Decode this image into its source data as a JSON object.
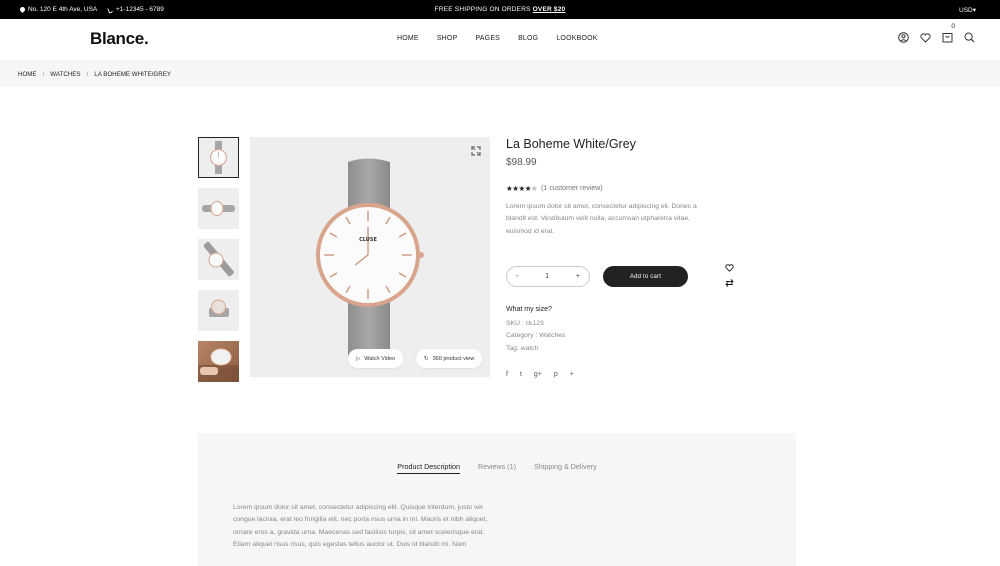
{
  "topbar": {
    "address": "No. 120 E 4th Ave, USA",
    "phone": "+1-12345 - 6789",
    "promo_text": "FREE SHIPPING ON ORDERS",
    "promo_amount": "OVER $20",
    "currency": "USD"
  },
  "header": {
    "logo": "Blance.",
    "nav": [
      "HOME",
      "SHOP",
      "PAGES",
      "BLOG",
      "LOOKBOOK"
    ],
    "cart_count": "0",
    "icons": [
      "user-icon",
      "heart-icon",
      "cart-icon",
      "search-icon"
    ]
  },
  "breadcrumb": [
    "HOME",
    "WATCHES",
    "LA BOHEME WHITE/GREY"
  ],
  "gallery": {
    "brand_on_dial": "CLUSE",
    "video_label": "Watch Video",
    "view360_label": "360 product view"
  },
  "product": {
    "title": "La Boheme White/Grey",
    "price": "$98.99",
    "rating_stars": 4,
    "rating_max": 5,
    "review_text": "(1 customer review)",
    "description": "Lorem ipsum dolor sit amet, consectetur adipiscing eli. Donec a blandit est. Vestibulum velit nulla, accumsan utpharetra vitae, euismod id erat.",
    "qty_minus": "-",
    "qty_value": "1",
    "qty_plus": "+",
    "add_to_cart": "Add to cart",
    "size_link": "What my size?",
    "sku": "SKU : ck123",
    "category": "Category : Watches",
    "tag": "Tag: watch",
    "social": [
      "f",
      "t",
      "g+",
      "p",
      "+"
    ]
  },
  "tabs": {
    "items": [
      "Product Description",
      "Reviews (1)",
      "Shipping & Delivery"
    ],
    "active": 0,
    "body": "Lorem ipsum dolor sit amet, consectetur adipiscing elit. Quisque interdum, justo vel congue lacinia, erat leo fringilla elit, nec porta risus urna in mi. Mauris et nibh aliquet, ornare eros a, gravida urna. Maecenas sed facilisis turpis, sit amet scelerisque erat. Etiam aliquet risus risus, quis egestas tellus auctor ut. Duis id blandit mi. Nam"
  },
  "colors": {
    "topbar_bg": "#000000",
    "accent_dark": "#222222",
    "muted_text": "#888888",
    "panel_bg": "#f6f6f6",
    "strap_grey": "#9c9c9c",
    "rose_gold": "#d9a48c"
  }
}
